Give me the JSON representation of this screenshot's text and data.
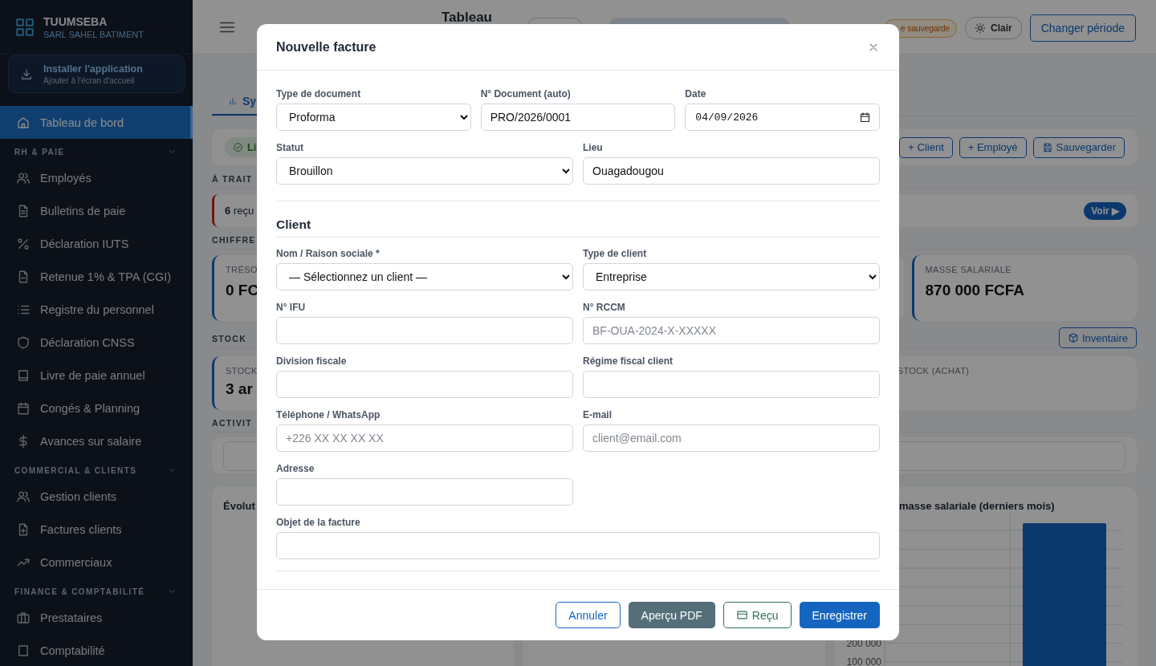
{
  "sidebar": {
    "brand": "TUUMSEBA",
    "company": "SARL SAHEL BATIMENT",
    "install": {
      "title": "Installer l'application",
      "subtitle": "Ajouter à l'écran d'accueil"
    },
    "nav": [
      {
        "kind": "item",
        "label": "Tableau de bord",
        "selected": true
      },
      {
        "kind": "section",
        "label": "RH & PAIE",
        "expanded": true,
        "children": [
          {
            "label": "Employés",
            "selected": false
          },
          {
            "label": "Bulletins de paie",
            "selected": false
          },
          {
            "label": "Déclaration IUTS",
            "selected": false
          },
          {
            "label": "Retenue 1% & TPA (CGI)",
            "selected": false
          },
          {
            "label": "Registre du personnel",
            "selected": false
          },
          {
            "label": "Déclaration CNSS",
            "selected": false
          },
          {
            "label": "Livre de paie annuel",
            "selected": false
          },
          {
            "label": "Congés & Planning",
            "selected": false
          },
          {
            "label": "Avances sur salaire",
            "selected": false
          }
        ]
      },
      {
        "kind": "section",
        "label": "COMMERCIAL & CLIENTS",
        "expanded": true,
        "children": [
          {
            "label": "Gestion clients",
            "selected": false
          },
          {
            "label": "Factures clients",
            "selected": false
          },
          {
            "label": "Commerciaux",
            "selected": false
          }
        ]
      },
      {
        "kind": "section",
        "label": "FINANCE & COMPTABILITÉ",
        "expanded": true,
        "children": [
          {
            "label": "Prestataires",
            "selected": false
          },
          {
            "label": "Comptabilité",
            "selected": false
          }
        ]
      }
    ]
  },
  "topbar": {
    "title": "Tableau",
    "save_status": "e sauvegarde",
    "theme_button": "Clair",
    "period_button": "Changer période"
  },
  "tabs": [
    {
      "label": "Sy",
      "selected": true
    }
  ],
  "toolbar": {
    "license": "Li",
    "buttons": [
      {
        "label": "+ Client",
        "kind": "plain"
      },
      {
        "label": "+ Employé",
        "kind": "plain"
      },
      {
        "label": "Sauvegarder",
        "kind": "save"
      }
    ]
  },
  "to_process": {
    "heading": "À TRAIT",
    "alert": "**6** reçu",
    "action": "Voir ▶"
  },
  "figures": {
    "heading": "CHIFFRE",
    "cards": [
      {
        "label": "TRÉSO",
        "value": "0 FC"
      },
      {
        "label": "MASSE SALARIALE",
        "value": "870 000 FCFA"
      }
    ]
  },
  "stock": {
    "heading": "STOCK",
    "button": "Inventaire",
    "cards": [
      {
        "label": "STOCK",
        "value": "3 ar"
      },
      {
        "label": "STOCK (ACHAT)"
      }
    ]
  },
  "activity": {
    "heading": "ACTIVIT"
  },
  "charts": {
    "left_title": "Évolut",
    "right_title": "masse salariale (derniers mois)",
    "axis_labels": [
      "200 000",
      "100 000"
    ]
  },
  "modal": {
    "title": "Nouvelle facture",
    "sections": [
      {
        "rows": [
          [
            {
              "label": "Type de document",
              "kind": "select",
              "value": "Proforma"
            },
            {
              "label": "N° Document (auto)",
              "kind": "text",
              "value": "PRO/2026/0001"
            },
            {
              "label": "Date",
              "kind": "date",
              "value": "04/09/2026"
            }
          ],
          [
            {
              "label": "Statut",
              "kind": "select",
              "value": "Brouillon"
            },
            {
              "label": "Lieu",
              "kind": "text",
              "value": "Ouagadougou"
            }
          ]
        ]
      },
      {
        "heading": "Client",
        "rows": [
          [
            {
              "label": "Nom / Raison sociale *",
              "kind": "select",
              "value": "— Sélectionnez un client —"
            },
            {
              "label": "Type de client",
              "kind": "select",
              "value": "Entreprise"
            }
          ],
          [
            {
              "label": "N° IFU",
              "kind": "text"
            },
            {
              "label": "N° RCCM",
              "kind": "text",
              "placeholder": "BF-OUA-2024-X-XXXXX"
            }
          ],
          [
            {
              "label": "Division fiscale",
              "kind": "text"
            },
            {
              "label": "Régime fiscal client",
              "kind": "text"
            }
          ],
          [
            {
              "label": "Téléphone / WhatsApp",
              "kind": "text",
              "placeholder": "+226 XX XX XX XX"
            },
            {
              "label": "E-mail",
              "kind": "text",
              "placeholder": "client@email.com"
            }
          ],
          [
            {
              "label": "Adresse",
              "kind": "text"
            }
          ],
          [
            {
              "label": "Objet de la facture",
              "kind": "text",
              "full_width": true
            }
          ]
        ]
      }
    ],
    "buttons": [
      {
        "label": "Annuler",
        "kind": "outline"
      },
      {
        "label": "Aperçu PDF",
        "kind": "secondary"
      },
      {
        "label": "Reçu",
        "kind": "receipt"
      },
      {
        "label": "Enregistrer",
        "kind": "primary"
      }
    ]
  }
}
